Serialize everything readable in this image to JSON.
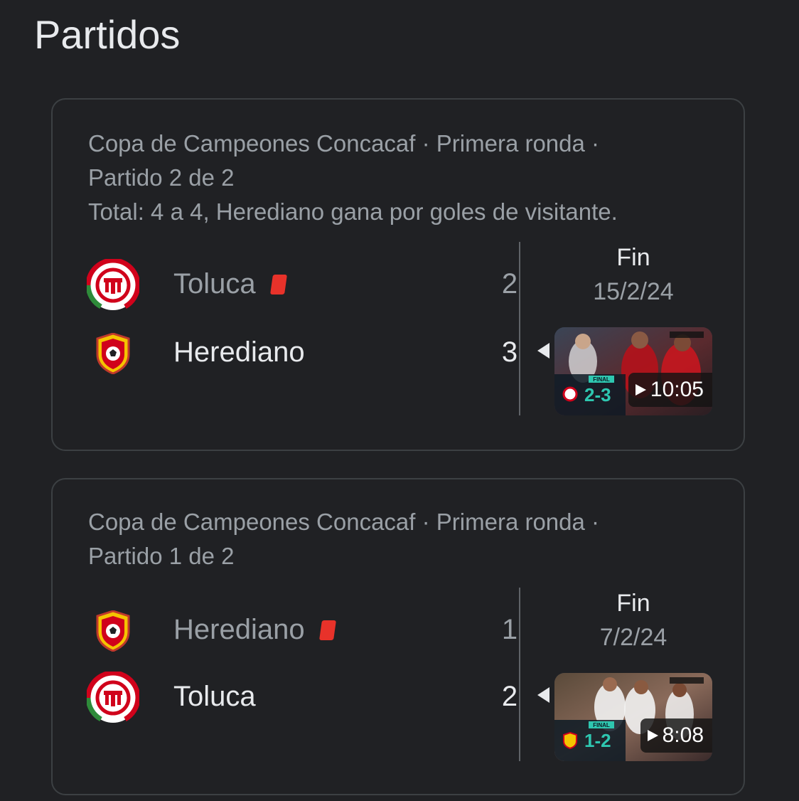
{
  "page": {
    "title": "Partidos"
  },
  "matches": [
    {
      "header_lines": [
        "Copa de Campeones Concacaf · Primera ronda ·",
        "Partido 2 de 2",
        "Total: 4 a 4, Herediano gana por goles de visitante."
      ],
      "home": {
        "name": "Toluca",
        "score": "2",
        "red_card": true,
        "logo": "toluca-crest"
      },
      "away": {
        "name": "Herediano",
        "score": "3",
        "red_card": false,
        "logo": "herediano-crest"
      },
      "status": "Fin",
      "date": "15/2/24",
      "highlight": {
        "duration": "10:05",
        "overlay_score": "2-3",
        "overlay_label": "FINAL"
      }
    },
    {
      "header_lines": [
        "Copa de Campeones Concacaf · Primera ronda ·",
        "Partido 1 de 2"
      ],
      "home": {
        "name": "Herediano",
        "score": "1",
        "red_card": true,
        "logo": "herediano-crest"
      },
      "away": {
        "name": "Toluca",
        "score": "2",
        "red_card": false,
        "logo": "toluca-crest"
      },
      "status": "Fin",
      "date": "7/2/24",
      "highlight": {
        "duration": "8:08",
        "overlay_score": "1-2",
        "overlay_label": "FINAL"
      }
    }
  ],
  "colors": {
    "background": "#202124",
    "card_border": "#3c4043",
    "text_primary": "#e8eaed",
    "text_secondary": "#9aa0a6",
    "red_card": "#e8322a",
    "toluca_red": "#d0021b",
    "herediano_yellow": "#f5c400"
  }
}
